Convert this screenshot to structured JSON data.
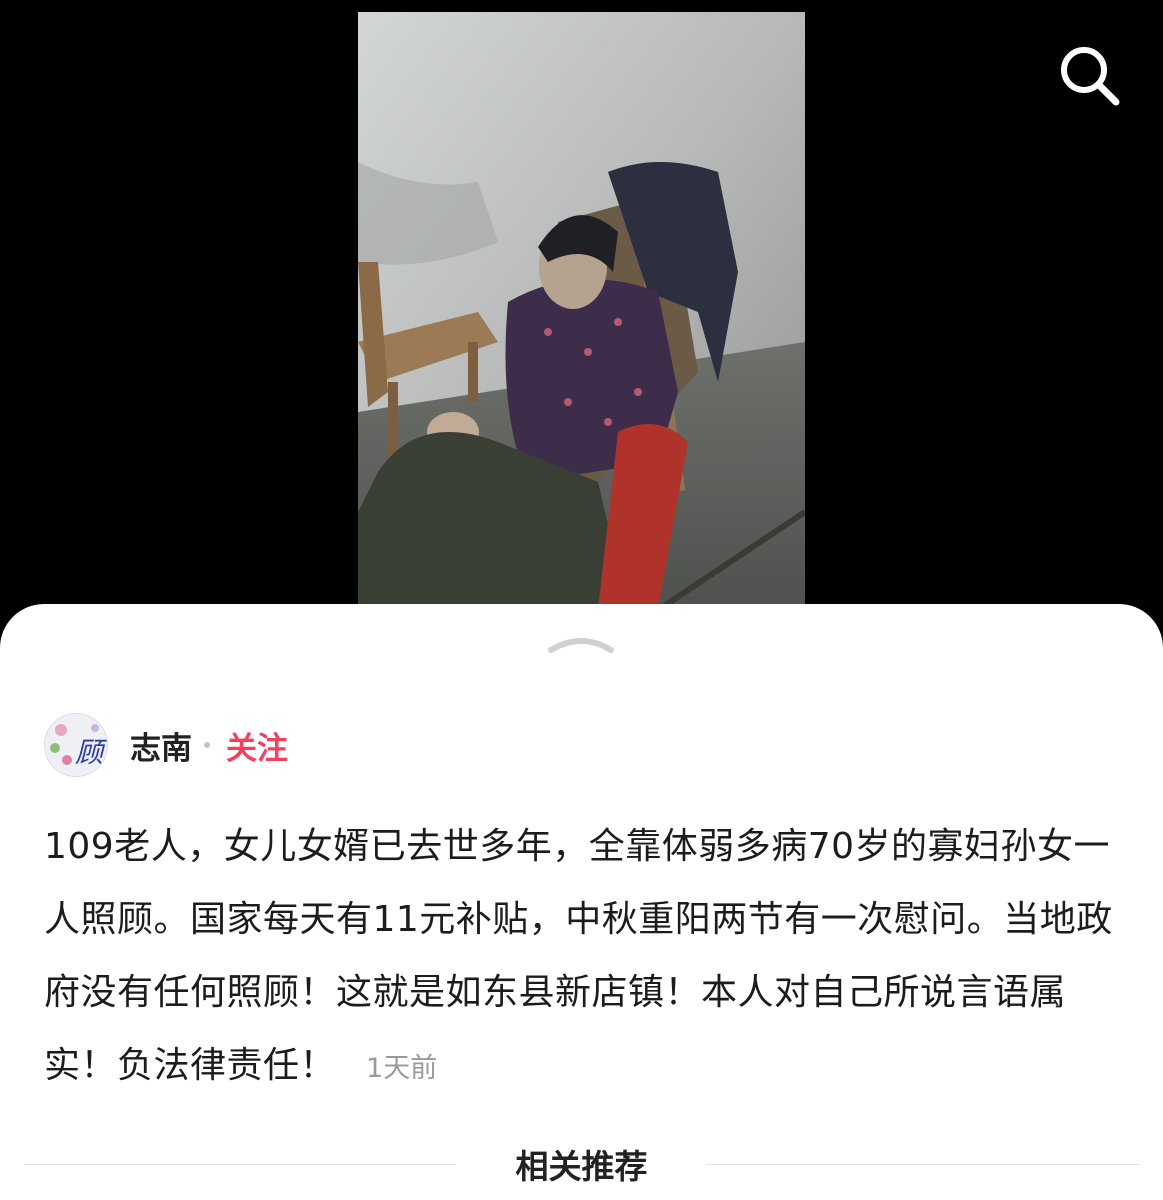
{
  "icons": {
    "search": "search-icon",
    "handle": "chevron-up-icon"
  },
  "author": {
    "name": "志南",
    "follow_label": "关注",
    "avatar_text": "顾"
  },
  "post": {
    "text": "109老人，女儿女婿已去世多年，全靠体弱多病70岁的寡妇孙女一人照顾。国家每天有11元补贴，中秋重阳两节有一次慰问。当地政府没有任何照顾！这就是如东县新店镇！本人对自己所说言语属实！负法律责任！",
    "time": "1天前"
  },
  "related": {
    "title": "相关推荐"
  },
  "colors": {
    "follow": "#f2405e",
    "background_top": "#000000",
    "sheet": "#ffffff"
  }
}
